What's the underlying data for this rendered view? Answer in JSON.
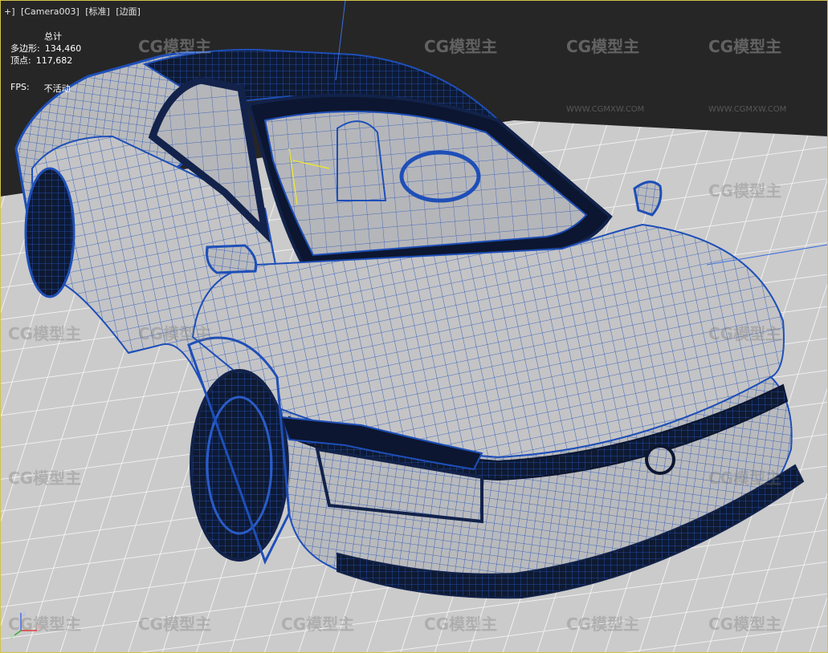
{
  "viewport": {
    "menu": [
      "+]",
      "[Camera003]",
      "[标准]",
      "[边面]"
    ]
  },
  "stats": {
    "title": "总计",
    "polygons_label": "多边形:",
    "polygons_value": "134,460",
    "vertices_label": "顶点:",
    "vertices_value": "117,682",
    "fps_label": "FPS:",
    "fps_value": "不活动"
  },
  "watermark": {
    "brand": "CG模型主",
    "url": "WWW.CGMXW.COM"
  },
  "gizmo": {
    "axes": [
      "x",
      "y",
      "z"
    ],
    "colors": {
      "x": "#e03a3a",
      "y": "#3ab03a",
      "z": "#4a6ae0"
    }
  },
  "colors": {
    "wire": "#1e4fb8",
    "floor": "#c9c9c9",
    "background": "#272727",
    "viewport_border": "#d4c24a"
  }
}
